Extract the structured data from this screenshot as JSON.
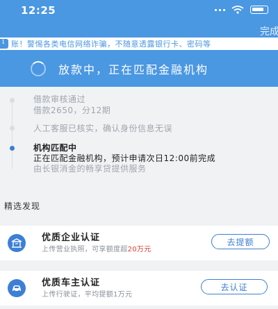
{
  "status_bar": {
    "time": "12:25"
  },
  "header": {
    "done_label": "完成"
  },
  "notice": {
    "text": "账！警惕各类电信网络诈骗，不随意透露银行卡、密码等"
  },
  "loan_status": {
    "text": "放款中，正在匹配金融机构"
  },
  "timeline": {
    "steps": [
      {
        "title": "借款审核通过",
        "detail": "借款2650，分12期"
      },
      {
        "title": "人工客服已核实，确认身份信息无误"
      },
      {
        "title": "机构匹配中",
        "detail": "正在匹配金融机构，预计申请次日12:00前完成",
        "detail2": "由长银消金的畅享贷提供服务"
      }
    ]
  },
  "discover": {
    "title": "精选发现",
    "cards": [
      {
        "title": "优质企业认证",
        "sub_prefix": "上传营业执照，可享额度超",
        "sub_highlight": "20万元",
        "button": "去提额"
      },
      {
        "title": "优质车主认证",
        "sub": "上传行驶证，平均提额1万元",
        "button": "去认证"
      }
    ]
  },
  "colors": {
    "primary": "#4a97e2",
    "accent": "#3b7ed2",
    "highlight": "#e03a2f",
    "background": "#f1f2f4"
  }
}
